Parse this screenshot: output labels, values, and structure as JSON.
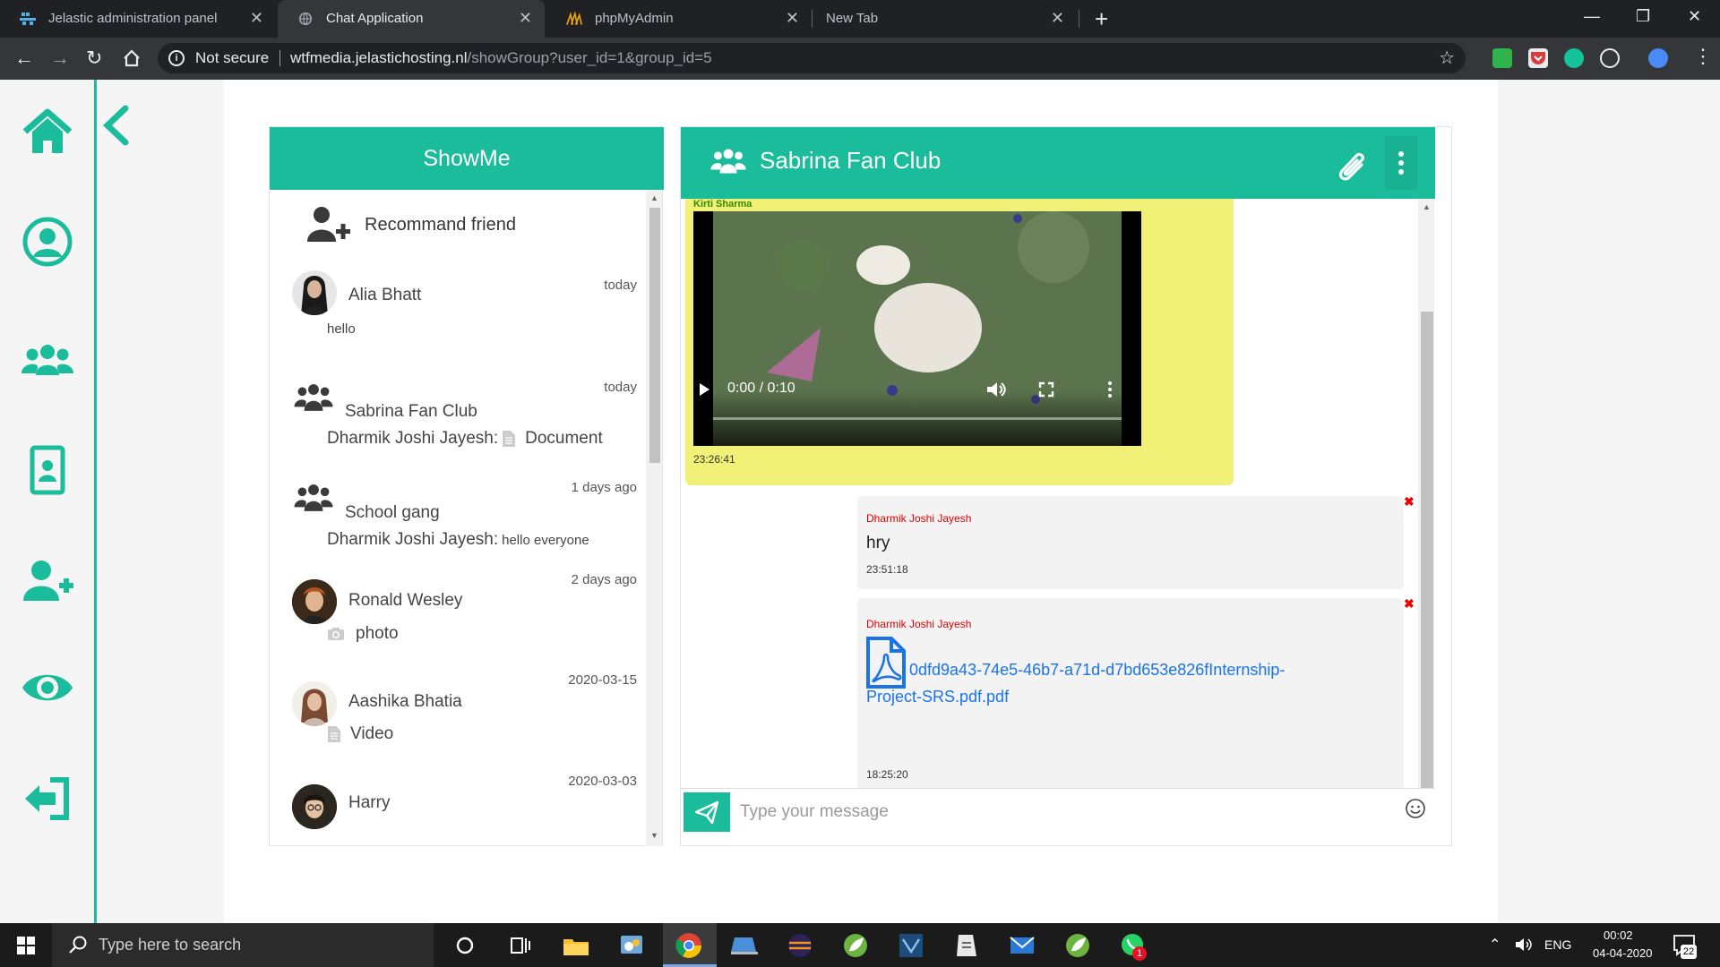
{
  "browser": {
    "tabs": [
      {
        "label": "Jelastic administration panel",
        "active": false
      },
      {
        "label": "Chat Application",
        "active": true
      },
      {
        "label": "phpMyAdmin",
        "active": false
      },
      {
        "label": "New Tab",
        "active": false
      }
    ],
    "security_label": "Not secure",
    "url_host": "wtfmedia.jelastichosting.nl",
    "url_path": "/showGroup?user_id=1&group_id=5"
  },
  "colors": {
    "accent": "#1abc9c",
    "bubble_in": "#f0f176",
    "sender_in": "#2e8b00",
    "sender_out": "#dd0000",
    "link": "#1a73e8"
  },
  "sidebar": {
    "icons": [
      "home-icon",
      "profile-icon",
      "groups-icon",
      "contacts-icon",
      "add-friend-icon",
      "view-icon",
      "logout-icon"
    ]
  },
  "chat_list": {
    "title": "ShowMe",
    "recommend_label": "Recommand friend",
    "items": [
      {
        "name": "Alia Bhatt",
        "time": "today",
        "preview": "hello",
        "type": "user"
      },
      {
        "name": "Sabrina Fan Club",
        "time": "today",
        "preview_sender": "Dharmik Joshi Jayesh:",
        "preview": "Document",
        "type": "group"
      },
      {
        "name": "School gang",
        "time": "1 days ago",
        "preview_sender": "Dharmik Joshi Jayesh:",
        "preview": "hello everyone",
        "type": "group"
      },
      {
        "name": "Ronald Wesley",
        "time": "2 days ago",
        "preview": "photo",
        "type": "user"
      },
      {
        "name": "Aashika Bhatia",
        "time": "2020-03-15",
        "preview": "Video",
        "type": "user"
      },
      {
        "name": "Harry",
        "time": "2020-03-03",
        "preview": "",
        "type": "user"
      }
    ]
  },
  "conversation": {
    "title": "Sabrina Fan Club",
    "messages": [
      {
        "sender": "Kirti Sharma",
        "kind": "video",
        "video_time": "0:00 / 0:10",
        "video_progress": 0.0,
        "time": "23:26:41"
      },
      {
        "sender": "Dharmik Joshi Jayesh",
        "kind": "text",
        "text": "hry",
        "time": "23:51:18"
      },
      {
        "sender": "Dharmik Joshi Jayesh",
        "kind": "file",
        "file_line1": "0dfd9a43-74e5-46b7-a71d-d7bd653e826fInternship-",
        "file_line2": "Project-SRS.pdf.pdf",
        "time": "18:25:20"
      }
    ],
    "input_placeholder": "Type your message"
  },
  "taskbar": {
    "search_placeholder": "Type here to search",
    "language": "ENG",
    "clock_time": "00:02",
    "clock_date": "04-04-2020",
    "notification_count": "22",
    "whatsapp_badge": "1"
  }
}
